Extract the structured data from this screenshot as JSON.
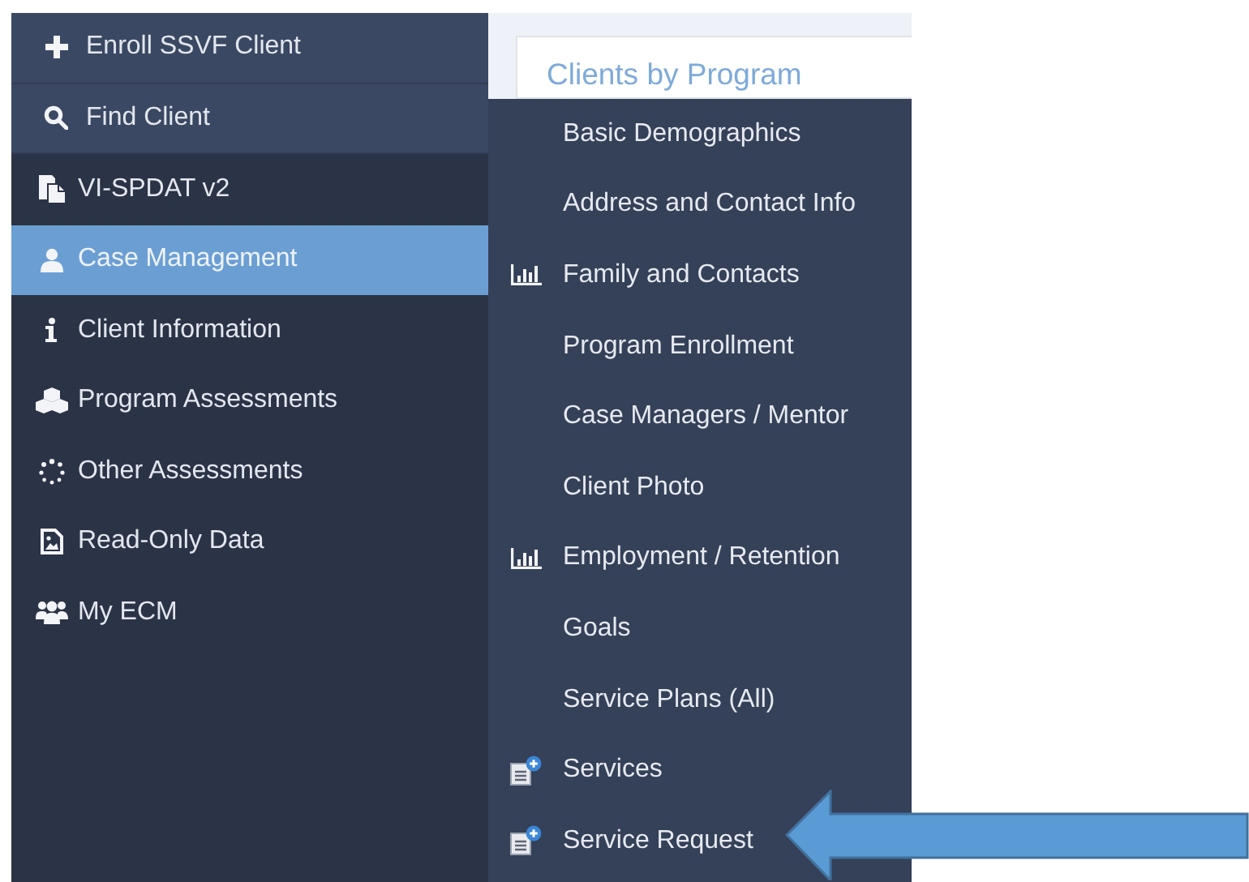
{
  "sidebar": {
    "items": [
      {
        "label": "Enroll SSVF Client",
        "kind": "top",
        "selected": false
      },
      {
        "label": "Find Client",
        "kind": "top",
        "selected": false
      },
      {
        "label": "VI-SPDAT v2",
        "kind": "main",
        "selected": false
      },
      {
        "label": "Case Management",
        "kind": "main",
        "selected": true
      },
      {
        "label": "Client Information",
        "kind": "main",
        "selected": false
      },
      {
        "label": "Program Assessments",
        "kind": "main",
        "selected": false
      },
      {
        "label": "Other Assessments",
        "kind": "main",
        "selected": false
      },
      {
        "label": "Read-Only Data",
        "kind": "main",
        "selected": false
      },
      {
        "label": "My ECM",
        "kind": "main",
        "selected": false
      }
    ]
  },
  "card": {
    "title": "Clients by Program"
  },
  "submenu": {
    "items": [
      {
        "label": "Basic Demographics",
        "kind": "plain"
      },
      {
        "label": "Address and Contact Info",
        "kind": "plain"
      },
      {
        "label": "Family and Contacts",
        "kind": "chart"
      },
      {
        "label": "Program Enrollment",
        "kind": "plain"
      },
      {
        "label": "Case Managers / Mentor",
        "kind": "plain"
      },
      {
        "label": "Client Photo",
        "kind": "plain"
      },
      {
        "label": "Employment / Retention",
        "kind": "chart"
      },
      {
        "label": "Goals",
        "kind": "plain"
      },
      {
        "label": "Service Plans (All)",
        "kind": "plain"
      },
      {
        "label": "Services",
        "kind": "service"
      },
      {
        "label": "Service Request",
        "kind": "service"
      }
    ]
  }
}
